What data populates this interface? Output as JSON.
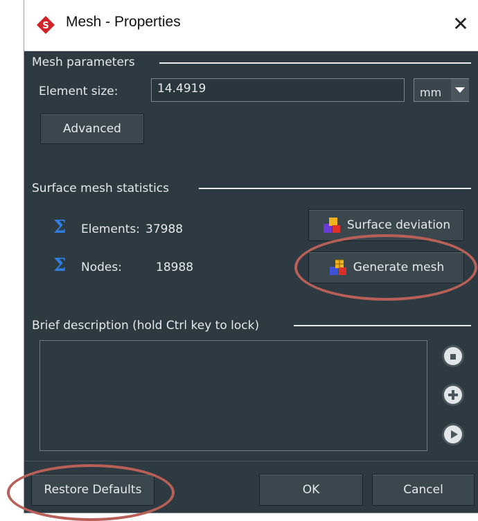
{
  "window": {
    "title": "Mesh - Properties",
    "close_glyph": "✕"
  },
  "mesh_parameters": {
    "section_label": "Mesh parameters",
    "element_size_label": "Element size:",
    "element_size_value": "14.4919",
    "unit_value": "mm",
    "advanced_label": "Advanced"
  },
  "statistics": {
    "section_label": "Surface mesh statistics",
    "elements_label": "Elements:",
    "elements_value": "37988",
    "nodes_label": "Nodes:",
    "nodes_value": "18988",
    "surface_deviation_label": "Surface deviation",
    "generate_mesh_label": "Generate mesh",
    "sigma_glyph": "Σ"
  },
  "description": {
    "section_label": "Brief description (hold Ctrl key to lock)",
    "text": ""
  },
  "footer": {
    "restore_label": "Restore Defaults",
    "ok_label": "OK",
    "cancel_label": "Cancel"
  },
  "colors": {
    "background": "#2d3a42",
    "accent_sigma": "#2f7de0",
    "annotation_ring": "#b85f58"
  },
  "icons": {
    "app": "app-logo-icon",
    "close": "close-icon",
    "dropdown": "chevron-down-icon",
    "surface_deviation": "cubes-icon",
    "generate_mesh": "mesh-cubes-icon",
    "sigma": "sigma-icon",
    "side": [
      "save-icon",
      "add-icon",
      "play-icon"
    ]
  }
}
